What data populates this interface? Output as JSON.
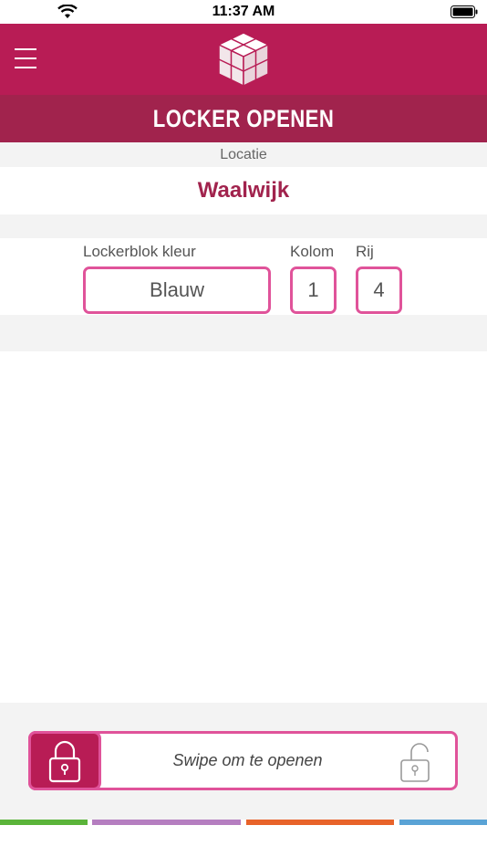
{
  "status_bar": {
    "time": "11:37 AM"
  },
  "header": {
    "title": "LOCKER OPENEN"
  },
  "location": {
    "label": "Locatie",
    "value": "Waalwijk"
  },
  "locker": {
    "color_label": "Lockerblok kleur",
    "color_value": "Blauw",
    "column_label": "Kolom",
    "column_value": "1",
    "row_label": "Rij",
    "row_value": "4"
  },
  "swipe": {
    "text": "Swipe om te openen"
  },
  "colors": {
    "primary": "#b81c55",
    "title_bar": "#a1234d",
    "accent_border": "#e0539a",
    "stripes": [
      "#5bb43a",
      "#b57ec0",
      "#e8632a",
      "#5aa3d6"
    ]
  },
  "icons": {
    "menu": "hamburger-menu-icon",
    "logo": "cube-logo",
    "locked": "padlock-locked-icon",
    "unlocked": "padlock-open-icon"
  }
}
